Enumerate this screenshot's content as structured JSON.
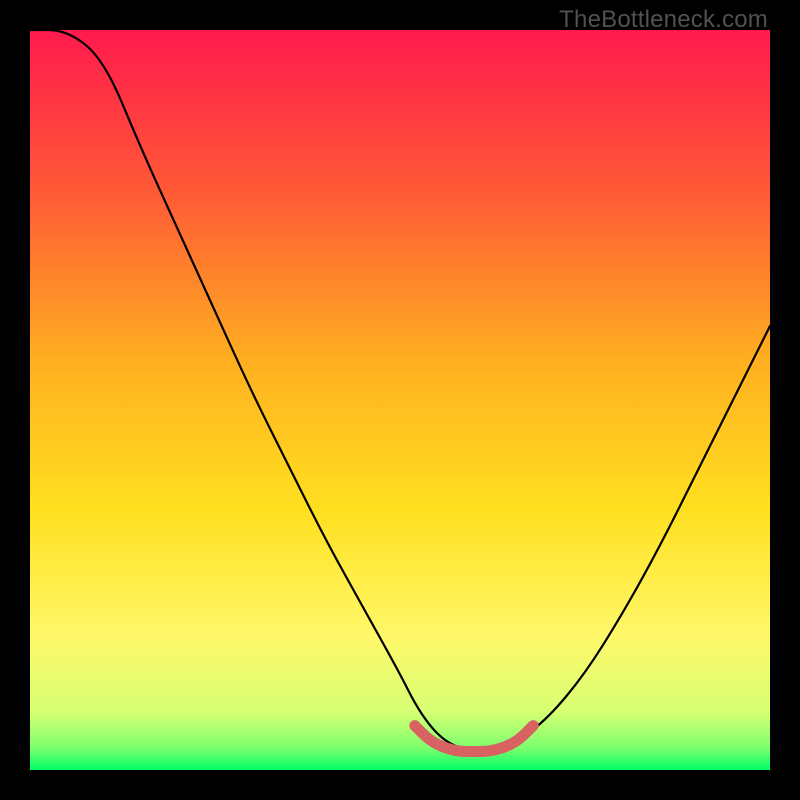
{
  "watermark": "TheBottleneck.com",
  "colors": {
    "gradient_top": "#ff1a4d",
    "gradient_mid_orange": "#ff8a2a",
    "gradient_mid_yellow": "#ffe020",
    "gradient_lower_yellow": "#fff86a",
    "gradient_near_bottom": "#d8ff73",
    "gradient_bottom": "#00ff66",
    "curve_stroke": "#000000",
    "highlight_stroke": "#d86262",
    "frame": "#000000"
  },
  "chart_data": {
    "type": "line",
    "title": "",
    "xlabel": "",
    "ylabel": "",
    "xlim": [
      0,
      100
    ],
    "ylim": [
      0,
      100
    ],
    "series": [
      {
        "name": "bottleneck-curve",
        "x": [
          0,
          5,
          10,
          15,
          20,
          25,
          30,
          35,
          40,
          45,
          50,
          52,
          54,
          56,
          58,
          60,
          62,
          64,
          66,
          70,
          75,
          80,
          85,
          90,
          95,
          100
        ],
        "values": [
          120,
          108,
          96,
          84,
          73,
          62,
          51,
          41,
          31,
          22,
          13,
          9,
          6,
          4,
          3,
          2.5,
          2.5,
          3,
          4,
          7,
          13,
          21,
          30,
          40,
          50,
          60
        ]
      }
    ],
    "highlight": {
      "name": "optimal-range",
      "x": [
        52,
        54,
        56,
        58,
        60,
        62,
        64,
        66,
        68
      ],
      "values": [
        6,
        4,
        3,
        2.5,
        2.5,
        2.5,
        3,
        4,
        6
      ]
    }
  }
}
